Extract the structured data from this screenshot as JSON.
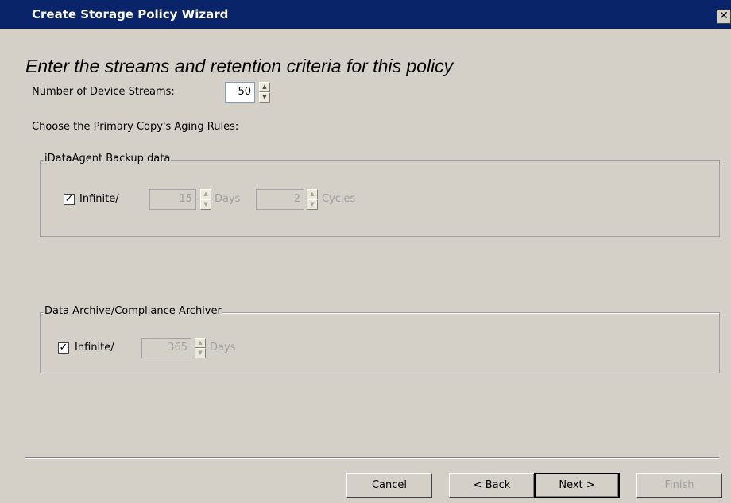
{
  "window": {
    "title": "Create Storage Policy Wizard",
    "close_glyph": "✕"
  },
  "heading": "Enter the streams and retention criteria for this policy",
  "streams": {
    "label": "Number of Device Streams:",
    "value": "50"
  },
  "aging_label": "Choose the Primary Copy's Aging Rules:",
  "backup_group": {
    "legend": "iDataAgent Backup data",
    "infinite_label": "Infinite/",
    "infinite_checked": true,
    "days_value": "15",
    "days_label": "Days",
    "cycles_value": "2",
    "cycles_label": "Cycles"
  },
  "archive_group": {
    "legend": "Data Archive/Compliance Archiver",
    "infinite_label": "Infinite/",
    "infinite_checked": true,
    "days_value": "365",
    "days_label": "Days"
  },
  "buttons": {
    "cancel": "Cancel",
    "back": "< Back",
    "next": "Next >",
    "finish": "Finish"
  },
  "check_glyph": "✓",
  "spin_up": "▲",
  "spin_down": "▼"
}
